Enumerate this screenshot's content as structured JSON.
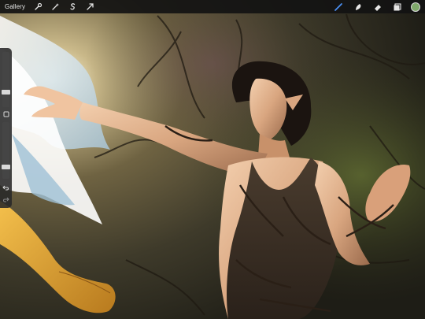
{
  "toolbar": {
    "gallery_label": "Gallery",
    "left_tools": [
      "wrench-icon",
      "magic-wand-icon",
      "selection-icon",
      "transform-icon"
    ],
    "right_tools": [
      "brush-icon",
      "smudge-icon",
      "eraser-icon",
      "layers-icon"
    ],
    "active_tool": "brush-icon",
    "active_color": "#7fa86a",
    "accent": "#4a8ef0"
  },
  "sidebar": {
    "brush_size_level": 0.25,
    "opacity_level": 0.18,
    "buttons": [
      "modify-square-icon",
      "undo-icon",
      "redo-icon"
    ]
  }
}
